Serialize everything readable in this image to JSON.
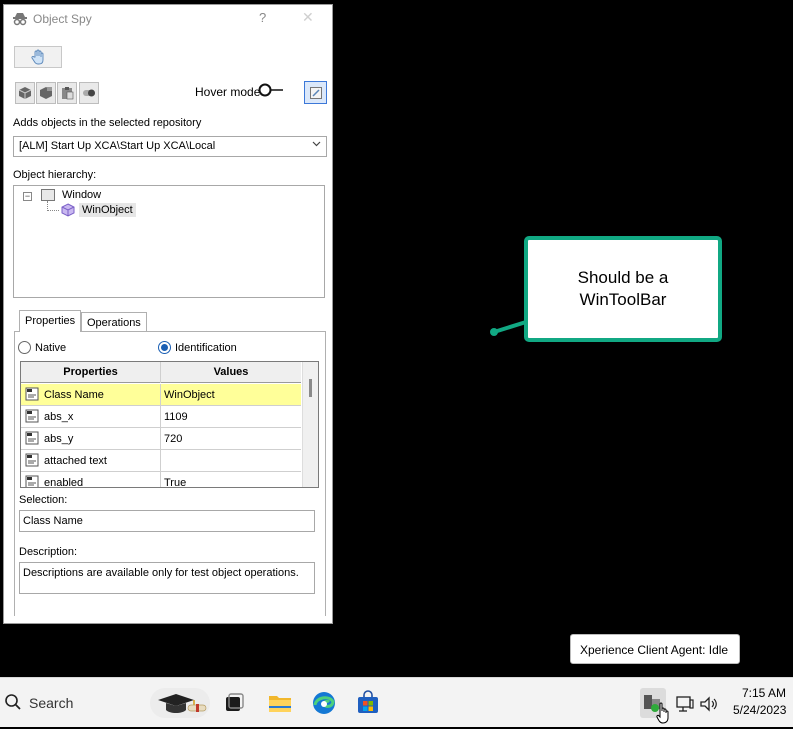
{
  "window": {
    "title": "Object Spy",
    "help_glyph": "?",
    "close_glyph": "✕"
  },
  "toolbar": {
    "hover_mode_label": "Hover mode"
  },
  "repository": {
    "label": "Adds objects in the selected repository",
    "selected": "[ALM] Start Up XCA\\Start Up XCA\\Local"
  },
  "hierarchy": {
    "label": "Object hierarchy:",
    "root": "Window",
    "child": "WinObject",
    "expander": "−"
  },
  "tabs": [
    {
      "label": "Properties"
    },
    {
      "label": "Operations"
    }
  ],
  "mode": {
    "native_label": "Native",
    "identification_label": "Identification",
    "selected": "Identification"
  },
  "grid": {
    "headers": [
      "Properties",
      "Values"
    ],
    "rows": [
      {
        "name": "Class Name",
        "value": "WinObject",
        "selected": true
      },
      {
        "name": "abs_x",
        "value": "1109"
      },
      {
        "name": "abs_y",
        "value": "720"
      },
      {
        "name": "attached text",
        "value": ""
      },
      {
        "name": "enabled",
        "value": "True"
      }
    ]
  },
  "selection": {
    "label": "Selection:",
    "value": "Class Name"
  },
  "description": {
    "label": "Description:",
    "value": "Descriptions are available only for test object operations."
  },
  "callout": {
    "line1": "Should be a",
    "line2": "WinToolBar",
    "color": "#11a883"
  },
  "tooltip": {
    "text": "Xperience Client Agent: Idle"
  },
  "taskbar": {
    "search_label": "Search",
    "time": "7:15 AM",
    "date": "5/24/2023",
    "apps": [
      "task-view",
      "file-explorer",
      "edge",
      "store"
    ]
  }
}
